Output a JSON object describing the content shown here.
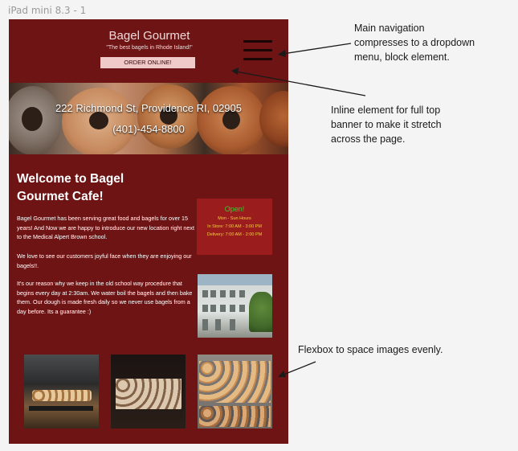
{
  "frame_label": "iPad mini 8.3 - 1",
  "header": {
    "brand": "Bagel Gourmet",
    "tagline": "\"The best bagels in Rhode Island!\"",
    "order_button": "ORDER ONLINE!"
  },
  "banner": {
    "address": "222 Richmond St, Providence RI, 02905",
    "phone": "(401)-454-8800"
  },
  "main": {
    "welcome_title": "Welcome to Bagel Gourmet Cafe!",
    "paragraphs": [
      "Bagel Gourmet has been serving great food and bagels for over 15 years! And Now we are happy to introduce our new location right next to the Medical Alpert Brown school.",
      "We love to see our customers joyful face when they are enjoying our bagels!!.",
      "It's our reason why we keep in the old school way procedure that begins every day at 2:30am. We water boil the bagels and then bake them. Our dough is made fresh daily so we never use bagels from a day before. Its a guarantee :)"
    ],
    "hours": {
      "status": "Open!",
      "days": "Mon - Sun Hours",
      "in_store": "In Store: 7:00 AM - 3:00 PM",
      "delivery": "Delivery: 7:00 AM - 2:00 PM"
    }
  },
  "annotations": {
    "nav": [
      "Main navigation",
      "compresses to a dropdown",
      "menu, block element."
    ],
    "banner": [
      "Inline element for full top",
      "banner to make it stretch",
      "across the page."
    ],
    "flexbox": [
      "Flexbox to space images evenly."
    ]
  },
  "colors": {
    "page_bg": "#6e1414",
    "hours_bg": "#9a1c1c",
    "open_text": "#30d030",
    "hours_text": "#f2d040",
    "order_button_bg": "#f0c9c9"
  }
}
